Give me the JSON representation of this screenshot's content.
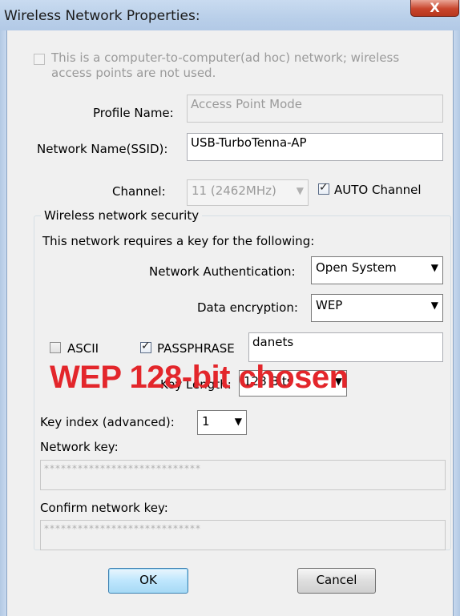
{
  "window": {
    "title": "Wireless Network Properties:",
    "close_glyph": "X"
  },
  "adhoc": {
    "label_line1": "This is a computer-to-computer(ad hoc) network; wireless",
    "label_line2": "access points are not used.",
    "checked": false
  },
  "profile": {
    "label": "Profile Name:",
    "value": "Access Point Mode"
  },
  "ssid": {
    "label": "Network Name(SSID):",
    "value": "USB-TurboTenna-AP"
  },
  "channel": {
    "label": "Channel:",
    "value": "11 (2462MHz)",
    "auto_label": "AUTO Channel",
    "auto_checked": true
  },
  "security": {
    "group_title": "Wireless network security",
    "intro": "This network requires a key for the following:",
    "auth_label": "Network Authentication:",
    "auth_value": "Open System",
    "enc_label": "Data encryption:",
    "enc_value": "WEP",
    "ascii_label": "ASCII",
    "ascii_checked": false,
    "passphrase_label": "PASSPHRASE",
    "passphrase_checked": true,
    "passphrase_value": "danets",
    "key_length_label": "Key Length:",
    "key_length_value": "128 Bits",
    "key_index_label": "Key index (advanced):",
    "key_index_value": "1",
    "network_key_label": "Network key:",
    "network_key_value": "****************************",
    "confirm_key_label": "Confirm network key:",
    "confirm_key_value": "****************************"
  },
  "overlay": {
    "text": "WEP 128-bit chosen",
    "color": "#e3262b"
  },
  "buttons": {
    "ok": "OK",
    "cancel": "Cancel"
  },
  "icons": {
    "dropdown": "chevron-down-icon",
    "close": "close-icon",
    "check": "checkmark-icon"
  }
}
